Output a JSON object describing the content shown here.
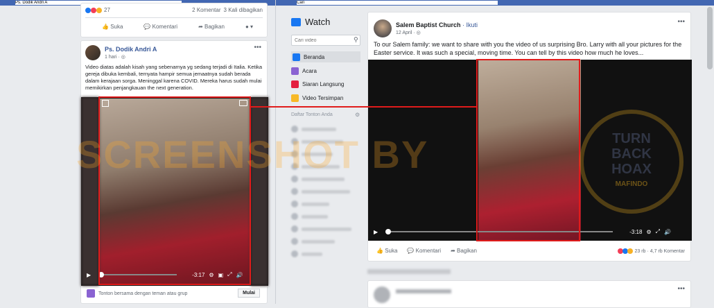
{
  "left": {
    "search_text": "Ps. Dodik Andri A",
    "prev_post": {
      "reaction_count": "27",
      "comments": "2 Komentar",
      "shares": "3 Kali dibagikan",
      "actions": {
        "like": "Suka",
        "comment": "Komentari",
        "share": "Bagikan"
      }
    },
    "post": {
      "author": "Ps. Dodik Andri A",
      "time": "1 hari",
      "text": "Video diatas adalah kisah yang sebenarnya yg sedang terjadi di Italia. Ketika gereja dibuka kembali, ternyata hampir semua jemaatnya sudah berada dalam kerajaan sorga. Meninggal karena COVID. Mereka harus sudah mulai memikirkan penjangkauan the next generation.",
      "video_time": "-3:17",
      "watch_party_text": "Tonton bersama dengan teman atau grup",
      "start_button": "Mulai"
    }
  },
  "right": {
    "search_text": "Cari",
    "watch_title": "Watch",
    "search_placeholder": "Cari video",
    "menu": [
      {
        "label": "Beranda",
        "color": "#1877f2"
      },
      {
        "label": "Acara",
        "color": "#8a63d2"
      },
      {
        "label": "Siaran Langsung",
        "color": "#e41e3f"
      },
      {
        "label": "Video Tersimpan",
        "color": "#f7b928"
      }
    ],
    "watchlist_title": "Daftar Tonton Anda",
    "post": {
      "author": "Salem Baptist Church",
      "follow": "Ikuti",
      "date": "12 April",
      "text": "To our Salem family: we want to share with you the video of us surprising Bro. Larry with all your pictures for the Easter service. It was such a special, moving time. You can tell by this video how much he loves...",
      "video_time": "-3:18",
      "actions": {
        "like": "Suka",
        "comment": "Komentari",
        "share": "Bagikan"
      },
      "reaction_count": "23 rb",
      "comments": "4,7 rb Komentar"
    }
  },
  "overlay": {
    "watermark": "SCREENSHOT BY",
    "seal_top": "TURN",
    "seal_mid": "BACK",
    "seal_bottom": "HOAX",
    "seal_name": "MAFINDO"
  },
  "colors": {
    "fb_blue": "#4267b2",
    "highlight_red": "#e01b1b"
  }
}
